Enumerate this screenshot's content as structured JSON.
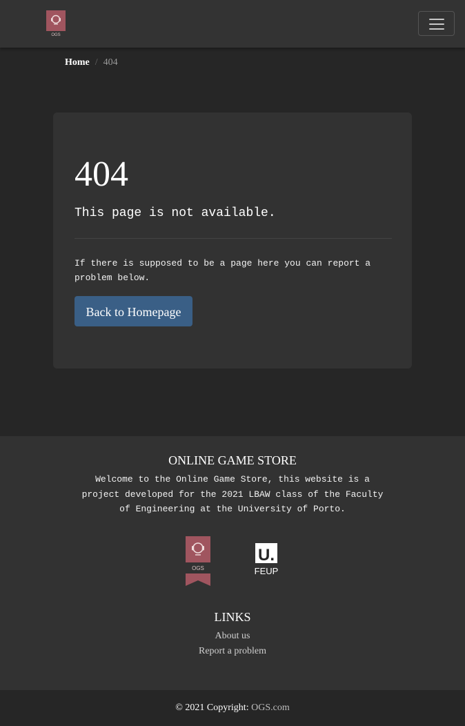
{
  "navbar": {
    "logo_text": "OGS",
    "toggler_icon": "hamburger-icon"
  },
  "breadcrumb": {
    "home": "Home",
    "separator": "/",
    "current": "404"
  },
  "error": {
    "code": "404",
    "message": "This page is not available.",
    "note": "If there is supposed to be a page here you can report a problem below.",
    "button_label": "Back to Homepage"
  },
  "footer": {
    "title": "ONLINE GAME STORE",
    "description": "Welcome to the Online Game Store, this website is a project developed for the 2021 LBAW class of the Faculty of Engineering at the University of Porto.",
    "ogs_logo_text": "OGS",
    "feup_logo_mark": "U.",
    "feup_logo_text": "FEUP",
    "links_title": "LINKS",
    "links": [
      "About us",
      "Report a problem"
    ]
  },
  "copyright": {
    "prefix": "© 2021 Copyright:",
    "site": "OGS.com"
  },
  "colors": {
    "background": "#262626",
    "surface": "#333333",
    "button": "#3a5f86",
    "logo": "#a0555f"
  }
}
